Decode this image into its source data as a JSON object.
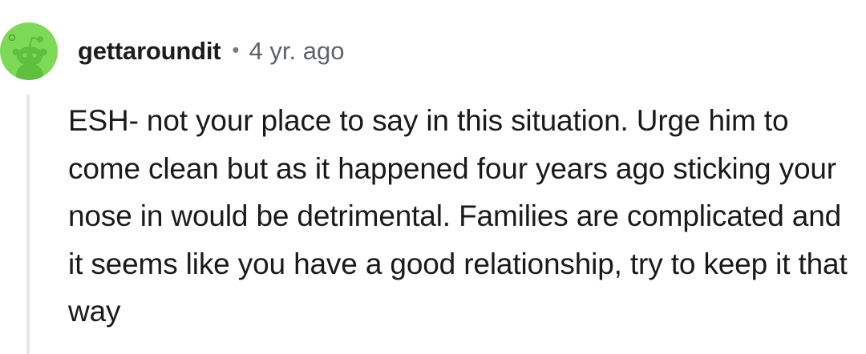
{
  "comment": {
    "author": "gettaroundit",
    "separator": "•",
    "timestamp": "4 yr. ago",
    "body": "ESH- not your place to say in this situation. Urge him to come clean but as it happened four years ago sticking your nose in would be detrimental. Families are complicated and it seems like you have a good relationship, try to keep it that way"
  },
  "colors": {
    "avatar_bg": "#7ed957",
    "avatar_figure": "#5fbf3f",
    "thread_line": "#e8e8e8",
    "meta_text": "#5f6368"
  },
  "icons": {
    "avatar": "reddit-snoo-avatar-icon"
  }
}
